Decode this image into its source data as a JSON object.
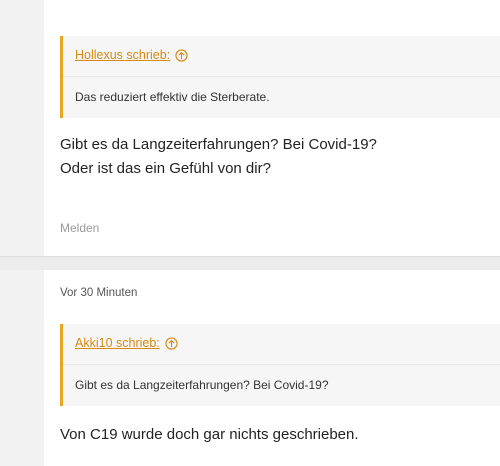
{
  "posts": [
    {
      "quote": {
        "author_label": "Hollexus schrieb:",
        "text": "Das reduziert effektiv die Sterberate."
      },
      "body": {
        "line1": "Gibt es da Langzeiterfahrungen? Bei Covid-19?",
        "line2": "Oder ist das ein Gefühl von dir?"
      },
      "report_label": "Melden"
    },
    {
      "timestamp": "Vor 30 Minuten",
      "quote": {
        "author_label": "Akki10 schrieb:",
        "text": "Gibt es da Langzeiterfahrungen? Bei Covid-19?"
      },
      "body": {
        "line1": "Von C19 wurde doch gar nichts geschrieben."
      }
    }
  ],
  "colors": {
    "accent": "#e8a623",
    "link": "#d68a14",
    "background": "#f2f2f2",
    "card": "#ffffff"
  },
  "icons": {
    "jump_to_quote": "arrow-up-circle-icon"
  }
}
